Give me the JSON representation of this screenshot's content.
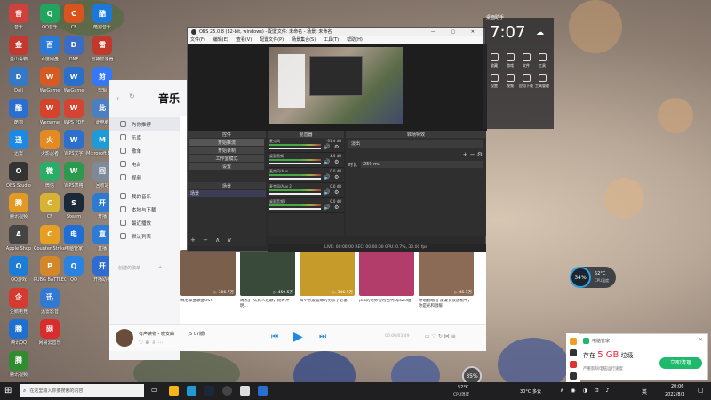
{
  "desktop_icons_col1": [
    {
      "label": "音乐",
      "color": "#d1413b"
    },
    {
      "label": "金山毒霸",
      "color": "#c3392f"
    },
    {
      "label": "Dell",
      "color": "#3478c6"
    },
    {
      "label": "酷狗",
      "color": "#2a6ed0"
    },
    {
      "label": "迅雷",
      "color": "#1e88e5"
    },
    {
      "label": "OBS Studio",
      "color": "#333333"
    },
    {
      "label": "腾讯视频",
      "color": "#e39a24"
    },
    {
      "label": "Apple Shop",
      "color": "#444444"
    },
    {
      "label": "QQ游戏",
      "color": "#1c7cd6"
    },
    {
      "label": "企鹅电竞",
      "color": "#d43a2f"
    },
    {
      "label": "腾讯QQ",
      "color": "#1e6fd2"
    },
    {
      "label": "腾讯视频",
      "color": "#2f8d2f"
    }
  ],
  "desktop_icons_col2": [
    {
      "label": "QQ音乐",
      "color": "#23a45c"
    },
    {
      "label": "百度网盘",
      "color": "#2b7ad8"
    },
    {
      "label": "WeGame",
      "color": "#d65a21"
    },
    {
      "label": "Wegame",
      "color": "#d6432b"
    },
    {
      "label": "火影忍者",
      "color": "#e48a22"
    },
    {
      "label": "微信",
      "color": "#2aae67"
    },
    {
      "label": "CF",
      "color": "#d8b233"
    },
    {
      "label": "Counter-Strike Global",
      "color": "#e69f25"
    },
    {
      "label": "PUBG BATTLEGR",
      "color": "#d38728"
    },
    {
      "label": "迅雷影音",
      "color": "#3479d1"
    },
    {
      "label": "网易云音乐",
      "color": "#d92c2c"
    }
  ],
  "desktop_icons_col3": [
    {
      "label": "CF",
      "color": "#d9531e"
    },
    {
      "label": "DNF",
      "color": "#3a6bc5"
    },
    {
      "label": "WeGame",
      "color": "#2b6fcd"
    },
    {
      "label": "WPS PDF",
      "color": "#d54432"
    },
    {
      "label": "WPS文字",
      "color": "#2d6fcc"
    },
    {
      "label": "WPS表格",
      "color": "#2b9a4e"
    },
    {
      "label": "Steam",
      "color": "#1b2838"
    },
    {
      "label": "电脑管家",
      "color": "#1e6ed5"
    },
    {
      "label": "QQ",
      "color": "#2a83e0"
    }
  ],
  "desktop_icons_col4": [
    {
      "label": "酷狗音乐",
      "color": "#1b78d8"
    },
    {
      "label": "雷神加速器",
      "color": "#c0392b"
    },
    {
      "label": "剪辑",
      "color": "#3478f6"
    },
    {
      "label": "此电脑",
      "color": "#4b7fc1"
    },
    {
      "label": "Microsoft Edge",
      "color": "#1e9bd7"
    },
    {
      "label": "回收站",
      "color": "#7c8a99"
    },
    {
      "label": "开播",
      "color": "#2f7ad1"
    },
    {
      "label": "直播",
      "color": "#2e7bd5"
    },
    {
      "label": "开播助手",
      "color": "#2e6cd2"
    }
  ],
  "music_app": {
    "title": "音乐",
    "sidebar": [
      {
        "label": "为你推荐"
      },
      {
        "label": "乐库"
      },
      {
        "label": "歌单"
      },
      {
        "label": "电台"
      },
      {
        "label": "视频"
      },
      {
        "label": "我的音乐"
      },
      {
        "label": "本地与下载"
      },
      {
        "label": "最近播放"
      },
      {
        "label": "默认列表"
      }
    ],
    "section_label": "我的音乐",
    "created_label": "创建的歌单",
    "cards": [
      {
        "title": "释厄录曲歌曲OST",
        "plays": "386.7万",
        "color": "#7a5f4c"
      },
      {
        "title": "周杰】 认真人之歌，比青神明...",
        "plays": "459.5万",
        "color": "#3a4a3a"
      },
      {
        "title": "每个热爱篮球的男孩子必备",
        "plays": "346.9万",
        "color": "#c79b2a"
      },
      {
        "title": "jojo的奇妙冒险百代Op&ed曲",
        "plays": "",
        "color": "#b23d6b"
      },
      {
        "title": "原唱翻唱 || 漫漫长夜放松中，你是光和温暖",
        "plays": "45.1万",
        "color": "#8b6b55"
      }
    ],
    "now_playing": "有声读物 - 晚安曲",
    "now_playing_sub": "(5 07版)",
    "time": "00:00/03:49"
  },
  "obs": {
    "title": "OBS 25.0.8 (32-bit, windows) - 配置文件: 未命名 - 场景: 未命名",
    "menu": [
      "文件(F)",
      "编辑(E)",
      "查看(V)",
      "配置文件(P)",
      "场景集合(S)",
      "工具(T)",
      "帮助(H)"
    ],
    "docks": {
      "scenes": "控件",
      "mixer": "混音器",
      "transitions": "转场特效",
      "sources": "场景"
    },
    "control_buttons": [
      "开始推流",
      "开始录制",
      "工作室模式",
      "设置"
    ],
    "source_item": "场景",
    "mixer_tracks": [
      {
        "name": "麦克风",
        "db": "-31.4 dB"
      },
      {
        "name": "桌面音频",
        "db": "-4.0 dB"
      },
      {
        "name": "麦克风/Aux",
        "db": "0.0 dB"
      },
      {
        "name": "麦克风/Aux 2",
        "db": "0.0 dB"
      },
      {
        "name": "桌面音频2",
        "db": "0.0 dB"
      }
    ],
    "transition_type": "淡出",
    "duration_label": "时长",
    "duration_value": "250 ms",
    "status": "LIVE: 00:00:00    REC: 00:00:00    CPU: 0.7%, 30.00 fps"
  },
  "right_panel": {
    "clock": "7:07",
    "label_top": "桌面助手",
    "items": [
      "收藏",
      "游戏",
      "文件",
      "工具",
      "设置",
      "视频",
      "应用下载",
      "工具管理"
    ]
  },
  "notification": {
    "app": "电脑管家",
    "text_pre": "存在",
    "amount": "5 GB",
    "text_post": "垃圾",
    "sub": "严重影响电脑运行速度",
    "button": "立即清理"
  },
  "widgets": {
    "cpu_percent": "34%",
    "cpu_temp": "52°C",
    "cpu_label": "CPU温度",
    "second_percent": "35%"
  },
  "taskbar": {
    "search_placeholder": "在这里输入你要搜索的内容",
    "temp": "52°C",
    "cpu_label": "CPU温度",
    "weather": "30°C 多云",
    "time": "20:06",
    "date": "2022/8/3",
    "lang": "英"
  },
  "colors": {
    "accent": "#1eb96b",
    "obs_bg": "#2b2b2b",
    "taskbar": "#1f1f22"
  }
}
